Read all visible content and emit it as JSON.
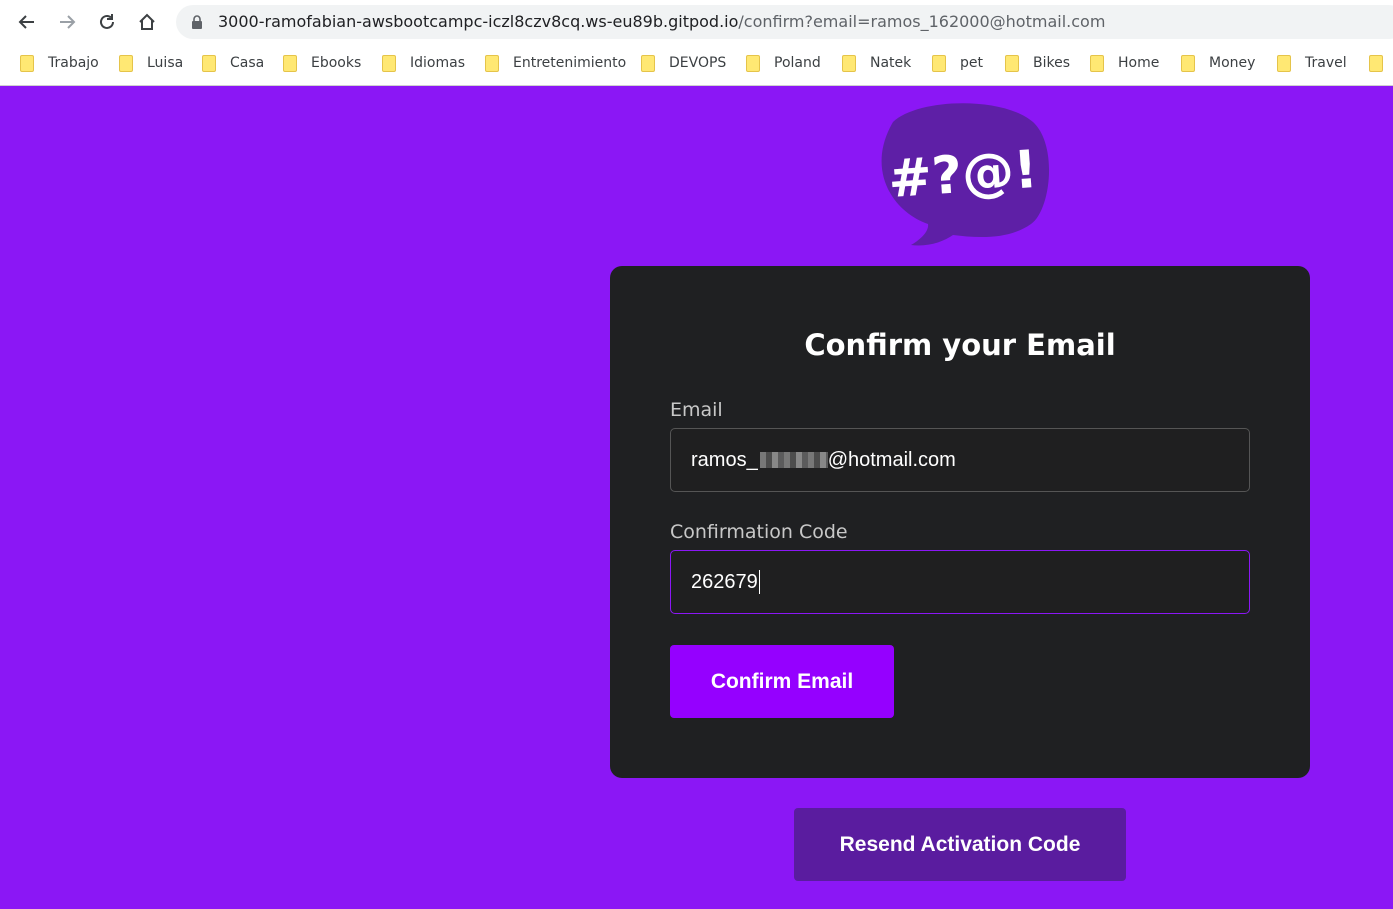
{
  "browser": {
    "url_host": "3000-ramofabian-awsbootcampc-iczl8czv8cq.ws-eu89b.gitpod.io",
    "url_path": "/confirm?email=ramos_162000@hotmail.com",
    "bookmarks": [
      "Trabajo",
      "Luisa",
      "Casa",
      "Ebooks",
      "Idiomas",
      "Entretenimiento",
      "DEVOPS",
      "Poland",
      "Natek",
      "pet",
      "Bikes",
      "Home",
      "Money",
      "Travel"
    ]
  },
  "logo": {
    "text": "#?@!"
  },
  "form": {
    "title": "Confirm your Email",
    "email_label": "Email",
    "email_prefix": "ramos_",
    "email_suffix": "@hotmail.com",
    "code_label": "Confirmation Code",
    "code_value": "262679",
    "confirm_button": "Confirm Email"
  },
  "resend_button": "Resend Activation Code",
  "colors": {
    "background": "#8B17F5",
    "card": "#1F2022",
    "primary_button": "#9500FF",
    "secondary_button": "#5A1C9F",
    "logo": "#5E1FA6"
  }
}
